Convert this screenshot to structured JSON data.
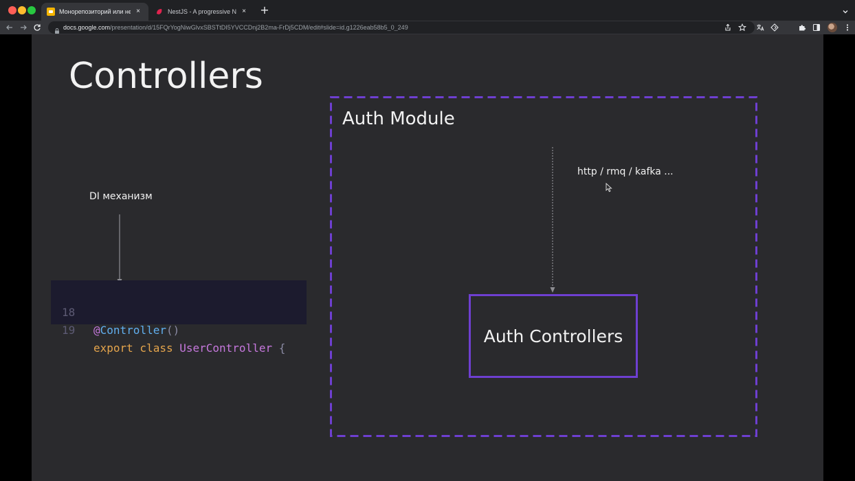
{
  "browser": {
    "tabs": [
      {
        "title": "Монорепозиторий или нет - ",
        "active": true,
        "favicon": "google-slides-icon",
        "favicon_color": "#f4b400"
      },
      {
        "title": "NestJS - A progressive Node.js",
        "active": false,
        "favicon": "nestjs-icon",
        "favicon_color": "#e0234e"
      }
    ],
    "new_tab_symbol": "+",
    "url": {
      "host": "docs.google.com",
      "path": "/presentation/d/15FQrYogNiwGlvxSBSTtDI5YVCCDnj2B2ma-FrDj5CDM/edit#slide=id.g1226eab58b5_0_249"
    }
  },
  "slide": {
    "title": "Controllers",
    "di_label": "DI механизм",
    "code": {
      "lines": [
        {
          "number": "18",
          "at": "@",
          "decorator": "Controller",
          "parens": "()"
        },
        {
          "number": "19",
          "keywords": "export class ",
          "class_name": "UserController",
          "brace": " {"
        }
      ]
    },
    "module_label": "Auth Module",
    "transport_label": "http / rmq /  kafka ...",
    "controllers_label": "Auth Controllers"
  },
  "colors": {
    "slide_background": "#2a2a2d",
    "accent_purple": "#6e3fd1",
    "code_background": "#1c1b2e",
    "text": "#f2f2f2"
  }
}
